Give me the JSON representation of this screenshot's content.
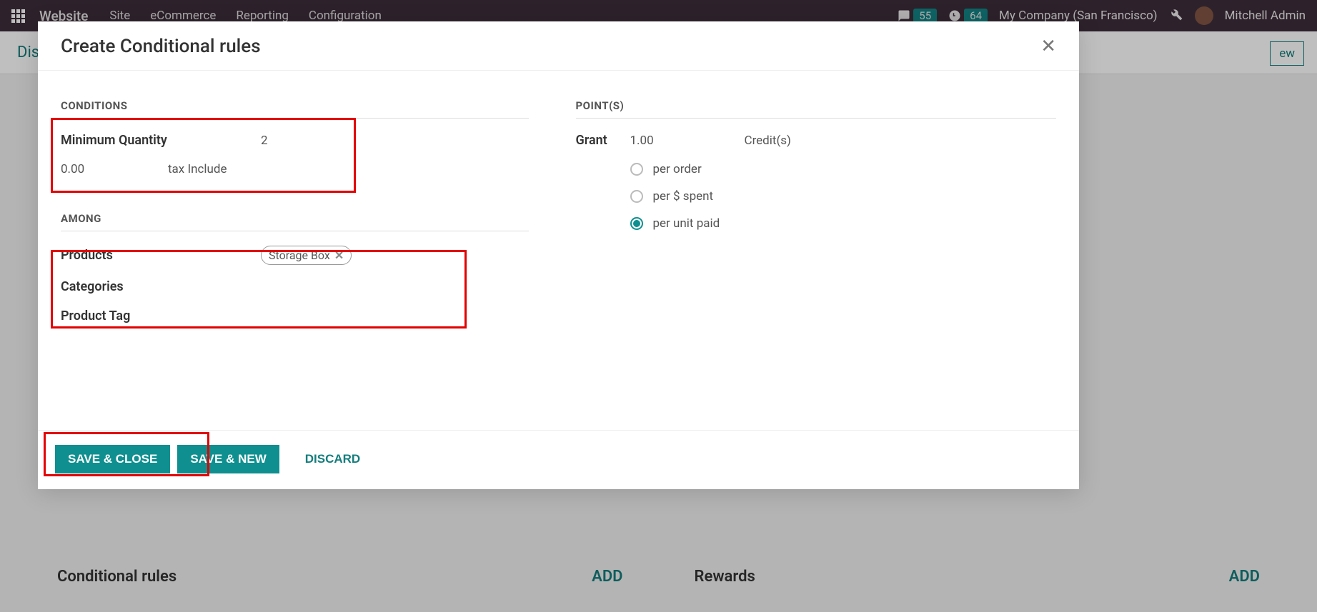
{
  "topbar": {
    "brand": "Website",
    "nav": [
      "Site",
      "eCommerce",
      "Reporting",
      "Configuration"
    ],
    "badge1": "55",
    "badge2": "64",
    "company": "My Company (San Francisco)",
    "user": "Mitchell Admin"
  },
  "page": {
    "breadcrumb": "Dis",
    "new": "ew"
  },
  "bottom": {
    "left_title": "Conditional rules",
    "right_title": "Rewards",
    "add": "ADD"
  },
  "modal": {
    "title": "Create Conditional rules",
    "conditions": {
      "heading": "Conditions",
      "min_qty_label": "Minimum Quantity",
      "min_qty_value": "2",
      "amount_value": "0.00",
      "tax_label": "tax Include"
    },
    "among": {
      "heading": "Among",
      "products_label": "Products",
      "product_tag": "Storage Box",
      "categories_label": "Categories",
      "product_tag_label": "Product Tag"
    },
    "points": {
      "heading": "Point(s)",
      "grant_label": "Grant",
      "grant_value": "1.00",
      "credits_label": "Credit(s)",
      "opt1": "per order",
      "opt2": "per $ spent",
      "opt3": "per unit paid"
    },
    "footer": {
      "save_close": "SAVE & CLOSE",
      "save_new": "SAVE & NEW",
      "discard": "DISCARD"
    }
  }
}
